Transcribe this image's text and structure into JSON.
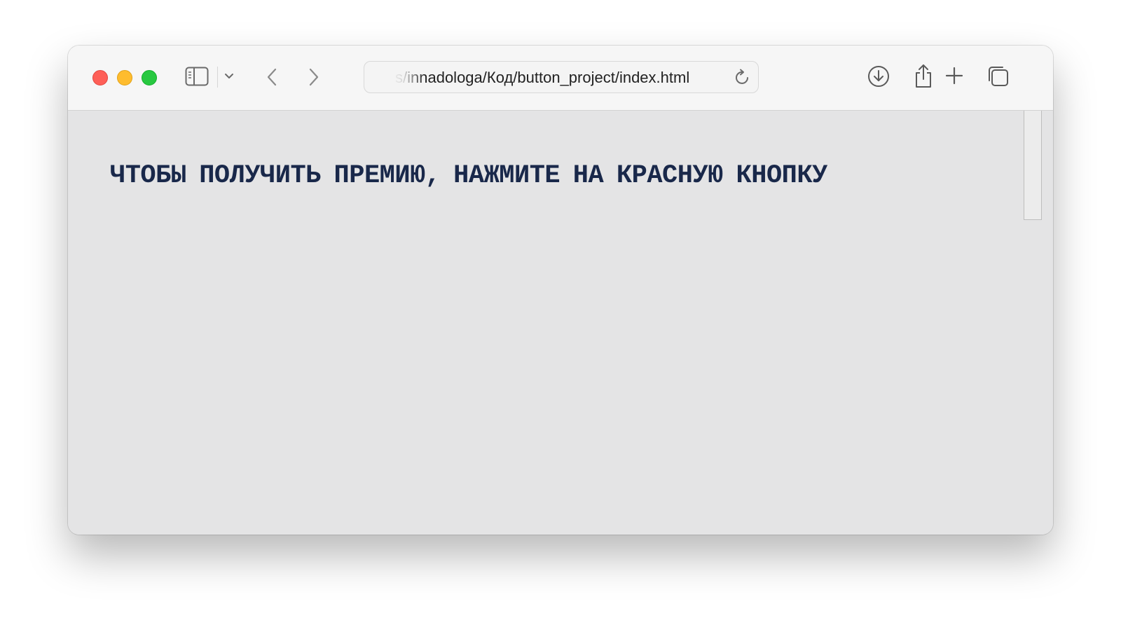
{
  "browser": {
    "address_bar": {
      "url_text": "s/innadologa/Код/button_project/index.html"
    },
    "icons": {
      "sidebar": "sidebar-icon",
      "tab_group_menu": "chevron-down-icon",
      "back": "chevron-left-icon",
      "forward": "chevron-right-icon",
      "reload": "reload-icon",
      "downloads": "download-icon",
      "share": "share-icon",
      "new_tab": "plus-icon",
      "tab_overview": "tabs-overview-icon"
    },
    "colors": {
      "close": "#fe5f57",
      "minimize": "#febc2e",
      "maximize": "#28c840",
      "toolbar_bg": "#f6f6f6"
    }
  },
  "page": {
    "headline": "ЧТОБЫ ПОЛУЧИТЬ ПРЕМИЮ, НАЖМИТЕ НА КРАСНУЮ КНОПКУ",
    "colors": {
      "background": "#e4e4e5",
      "headline": "#19284a"
    }
  }
}
